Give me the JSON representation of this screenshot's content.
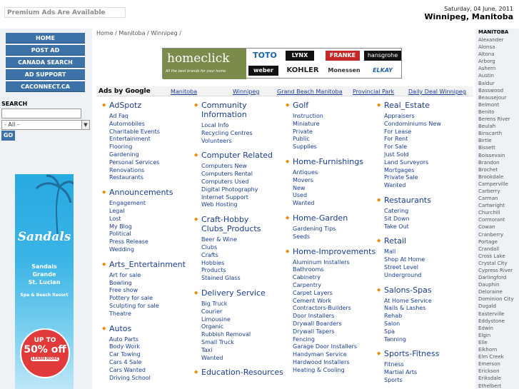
{
  "top": {
    "premium": "Premium Ads Are Available",
    "date": "Saturday, 04 June, 2011",
    "location": "Winnipeg, Manitoba"
  },
  "nav": [
    "HOME",
    "POST AD",
    "CANADA SEARCH",
    "AD SUPPORT",
    "CACONNECT.CA"
  ],
  "search": {
    "label": "SEARCH",
    "input_value": "",
    "select_value": "- All -",
    "go_label": "GO"
  },
  "sandals_ad": {
    "brand": "Sandals",
    "resort_line1": "Sandals",
    "resort_line2": "Grande",
    "resort_line3": "St. Lucian",
    "sub": "Spa & Beach Resort",
    "upto": "UP TO",
    "percent": "50% off",
    "learn": "LEARN MORE"
  },
  "breadcrumb": "Home / Manitoba / Winnipeg /",
  "banner": {
    "word": "homeclick",
    "tag": "All the best brands for your home",
    "logos": [
      "TOTO",
      "LYNX",
      "FRANKE",
      "hansgrohe",
      "weber",
      "KOHLER",
      "Monessen",
      "ELKAY"
    ]
  },
  "adsbar": {
    "label": "Ads by Google",
    "links": [
      "Manitoba",
      "Winnipeg",
      "Grand Beach Manitoba",
      "Provincial Park",
      "Daily Deal Winnipeg"
    ]
  },
  "columns": [
    [
      {
        "title": "AdSpotz",
        "items": [
          "Ad Faq",
          "Automobiles",
          "Charitable Events",
          "Entertainment",
          "Flooring",
          "Gardening",
          "Personal Services",
          "Renovations",
          "Restaurants"
        ]
      },
      {
        "title": "Announcements",
        "items": [
          "Engagement",
          "Legal",
          "Lost",
          "My Blog",
          "Political",
          "Press Release",
          "Wedding"
        ]
      },
      {
        "title": "Arts_Entertainment",
        "items": [
          "Art for sale",
          "Bowling",
          "Free show",
          "Pottery for sale",
          "Sculpting for sale",
          "Theatre"
        ]
      },
      {
        "title": "Autos",
        "items": [
          "Auto Parts",
          "Body Work",
          "Car Towing",
          "Cars 4 Sale",
          "Cars Wanted",
          "Driving School"
        ]
      }
    ],
    [
      {
        "title": "Community Information",
        "items": [
          "Local Info",
          "Recycling Centres",
          "Volunteers"
        ]
      },
      {
        "title": "Computer Related",
        "items": [
          "Computers New",
          "Computers Rental",
          "Computers Used",
          "Digital Photography",
          "Internet Support",
          "Web Hosting"
        ]
      },
      {
        "title": "Craft-Hobby Clubs_Products",
        "items": [
          "Beer & Wine",
          "Clubs",
          "Crafts",
          "Hobbies",
          "Products",
          "Stained Glass"
        ]
      },
      {
        "title": "Delivery Service",
        "items": [
          "Big Truck",
          "Courier",
          "Limousine",
          "Organic",
          "Rubbish Removal",
          "Small Truck",
          "Taxi",
          "Wanted"
        ]
      },
      {
        "title": "Education-Resources",
        "items": []
      }
    ],
    [
      {
        "title": "Golf",
        "items": [
          "Instruction",
          "Miniature",
          "Private",
          "Public",
          "Supplies"
        ]
      },
      {
        "title": "Home-Furnishings",
        "items": [
          "Antiques",
          "Movers",
          "New",
          "Used",
          "Wanted"
        ]
      },
      {
        "title": "Home-Garden",
        "items": [
          "Gardening Tips",
          "Seeds"
        ]
      },
      {
        "title": "Home-Improvements",
        "items": [
          "Aluminum Installers",
          "Bathrooms",
          "Cabinetry",
          "Carpentry",
          "Carpet Layers",
          "Cement Work",
          "Contractors-Builders",
          "Door Installers",
          "Drywall Boarders",
          "Drywall Tapers",
          "Fencing",
          "Garage Door Installers",
          "Handyman Service",
          "Hardwood Installers",
          "Heating & Cooling"
        ]
      }
    ],
    [
      {
        "title": "Real_Estate",
        "items": [
          "Appraisers",
          "Condominiums New",
          "For Lease",
          "For Rent",
          "For Sale",
          "Just Sold",
          "Land Surveyors",
          "Mortgages",
          "Private Sale",
          "Wanted"
        ]
      },
      {
        "title": "Restaurants",
        "items": [
          "Catering",
          "Sit Down",
          "Take Out"
        ]
      },
      {
        "title": "Retail",
        "items": [
          "Mall",
          "Shop At Home",
          "Street Level",
          "Underground"
        ]
      },
      {
        "title": "Salons-Spas",
        "items": [
          "At Home Service",
          "Nails & Lashes",
          "Rehab",
          "Salon",
          "Spa",
          "Tanning"
        ]
      },
      {
        "title": "Sports-Fitness",
        "items": [
          "Fitness",
          "Martial Arts",
          "Sports"
        ]
      }
    ]
  ],
  "cities": {
    "heading": "MANITOBA",
    "list": [
      "Alexander",
      "Alonsa",
      "Altona",
      "Arborg",
      "Ashern",
      "Austin",
      "Baldur",
      "Basswood",
      "Beausejour",
      "Belmont",
      "Benito",
      "Berens River",
      "Beulah",
      "Binscarth",
      "Birtle",
      "Bissett",
      "Boissevain",
      "Brandon",
      "Brochet",
      "Brookdale",
      "Camperville",
      "Carberry",
      "Carman",
      "Cartwright",
      "Churchill",
      "Cormorant",
      "Cowan",
      "Cranberry",
      "Portage",
      "Crandall",
      "Cross Lake",
      "Crystal City",
      "Cypress River",
      "Darlingford",
      "Dauphin",
      "Deloraine",
      "Dominion City",
      "Dugald",
      "Easterville",
      "Eddystone",
      "Edwin",
      "Elgin",
      "Elie",
      "Elkhorn",
      "Elm Creek",
      "Emerson",
      "Erickson",
      "Eriksdale",
      "Ethelbert"
    ]
  },
  "colors": {
    "nav_bg": "#3d72a8",
    "link": "#1a3c9a",
    "bullet": "#f08a00",
    "sidebar_bg": "#eef2f6"
  }
}
